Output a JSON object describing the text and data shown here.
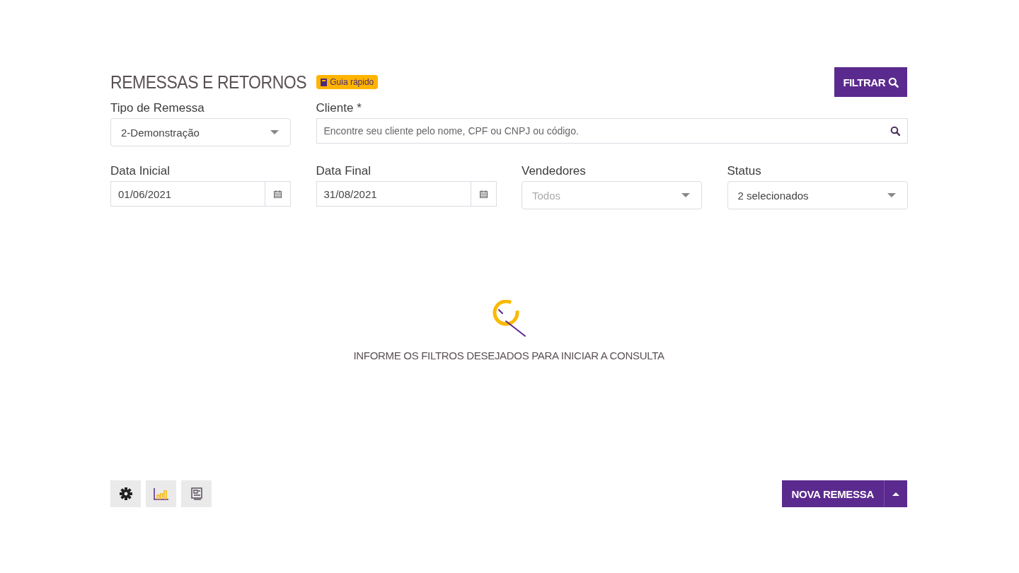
{
  "header": {
    "title": "REMESSAS E RETORNOS",
    "guide_badge": "Guia rápido",
    "filter_button": "FILTRAR"
  },
  "fields": [
    {
      "kind": "select",
      "label": "Tipo de Remessa",
      "value": "2-Demonstração"
    },
    {
      "kind": "search",
      "label": "Cliente *",
      "placeholder": "Encontre seu cliente pelo nome, CPF ou CNPJ ou código."
    },
    {
      "kind": "date",
      "label": "Data Inicial",
      "value": "01/06/2021"
    },
    {
      "kind": "date",
      "label": "Data Final",
      "value": "31/08/2021"
    },
    {
      "kind": "select",
      "label": "Vendedores",
      "placeholder": "Todos"
    },
    {
      "kind": "select",
      "label": "Status",
      "value": "2 selecionados"
    }
  ],
  "empty_state": {
    "message": "INFORME OS FILTROS DESEJADOS PARA INICIAR A CONSULTA"
  },
  "new_button": {
    "label": "NOVA REMESSA"
  }
}
